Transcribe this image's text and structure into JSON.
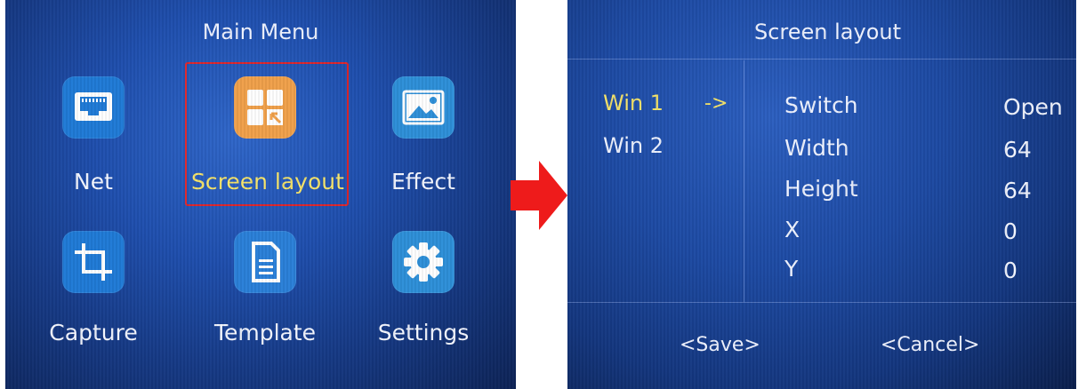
{
  "main_menu": {
    "title": "Main Menu",
    "items": [
      {
        "label": "Net",
        "icon": "network-port-icon",
        "color": "#1f7ad6"
      },
      {
        "label": "Screen layout",
        "icon": "screen-layout-icon",
        "color": "#f0a04a",
        "selected": true
      },
      {
        "label": "Effect",
        "icon": "image-icon",
        "color": "#2d8fd8"
      },
      {
        "label": "Capture",
        "icon": "crop-icon",
        "color": "#1f7ad6"
      },
      {
        "label": "Template",
        "icon": "document-icon",
        "color": "#2a7fd8"
      },
      {
        "label": "Settings",
        "icon": "gear-icon",
        "color": "#2d8fd8"
      }
    ],
    "selection_color": "#e0262b"
  },
  "transition_arrow": {
    "color": "#ee1b1b"
  },
  "screen_layout": {
    "title": "Screen layout",
    "windows": [
      {
        "label": "Win 1",
        "active": true
      },
      {
        "label": "Win 2",
        "active": false
      }
    ],
    "pointer": "->",
    "fields": [
      {
        "label": "Switch",
        "value": "Open"
      },
      {
        "label": "Width",
        "value": "64"
      },
      {
        "label": "Height",
        "value": "64"
      },
      {
        "label": "X",
        "value": "0"
      },
      {
        "label": "Y",
        "value": "0"
      }
    ],
    "save_label": "<Save>",
    "cancel_label": "<Cancel>",
    "highlight_color": "#f5e36a"
  }
}
